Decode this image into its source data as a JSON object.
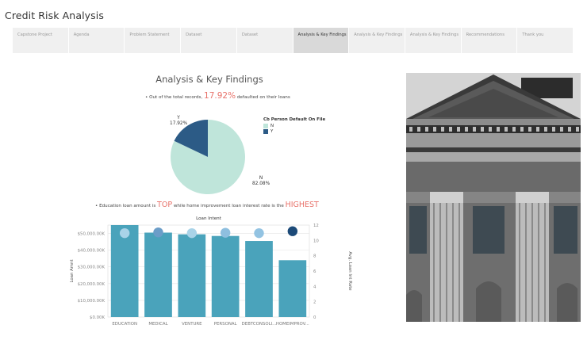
{
  "app": {
    "title": "Credit Risk Analysis"
  },
  "tabs": [
    {
      "label": "Capstone Project",
      "active": false
    },
    {
      "label": "Agenda",
      "active": false
    },
    {
      "label": "Problem Statement",
      "active": false
    },
    {
      "label": "Dataset",
      "active": false
    },
    {
      "label": "Dataset",
      "active": false
    },
    {
      "label": "Analysis & Key Findings",
      "active": true
    },
    {
      "label": "Analysis & Key Findings",
      "active": false
    },
    {
      "label": "Analysis & Key Findings",
      "active": false
    },
    {
      "label": "Recommendations",
      "active": false
    },
    {
      "label": "Thank you",
      "active": false
    }
  ],
  "section": {
    "title": "Analysis & Key Findings"
  },
  "note1": {
    "before": "• Out of the total records, ",
    "highlight": "17.92%",
    "after": " defaulted on their loans"
  },
  "note2": {
    "before": "• Education loan amount is ",
    "highlight1": "TOP",
    "middle": " while home improvement loan interest rate is the ",
    "highlight2": "HIGHEST"
  },
  "colors": {
    "pie_n": "#bfe5da",
    "pie_y": "#2c5b86",
    "bar": "#4aa3bb",
    "highlight": "#e8736b",
    "tab_active": "#d9d9d9",
    "tab_inactive": "#f0f0f0"
  },
  "chart_data": [
    {
      "type": "pie",
      "legend_title": "Cb Person Default On File",
      "legend_position": "right",
      "slices": [
        {
          "label": "N",
          "percent_text": "82.08%",
          "value": 82.08,
          "color": "#bfe5da"
        },
        {
          "label": "Y",
          "percent_text": "17.92%",
          "value": 17.92,
          "color": "#2c5b86"
        }
      ]
    },
    {
      "type": "bar",
      "title": "Loan Intent",
      "ylabel": "Loan Amnt",
      "y2label": "Avg. Loan Int Rate",
      "categories": [
        "EDUCATION",
        "MEDICAL",
        "VENTURE",
        "PERSONAL",
        "DEBTCONSOLI...",
        "HOMEIMPROV..."
      ],
      "values": [
        55000000,
        50500000,
        49500000,
        48500000,
        45500000,
        34000000
      ],
      "ylim": [
        0,
        55000000
      ],
      "yticks": [
        0,
        10000000,
        20000000,
        30000000,
        40000000,
        50000000
      ],
      "ytick_labels": [
        "$0.00K",
        "$10,000.00K",
        "$20,000.00K",
        "$30,000.00K",
        "$40,000.00K",
        "$50,000.00K"
      ],
      "y2lim": [
        0,
        12
      ],
      "y2ticks": [
        0,
        2,
        4,
        6,
        8,
        10,
        12
      ],
      "y2_values": [
        10.95,
        11.05,
        10.95,
        11.0,
        10.95,
        11.2
      ],
      "marker_colors": [
        "#a9d3e8",
        "#6b9dc8",
        "#a9d3e8",
        "#8ebfdf",
        "#93c3e2",
        "#1c4a78"
      ],
      "grid": true
    }
  ],
  "photo": {
    "subject": "neoclassical-building-facade"
  }
}
